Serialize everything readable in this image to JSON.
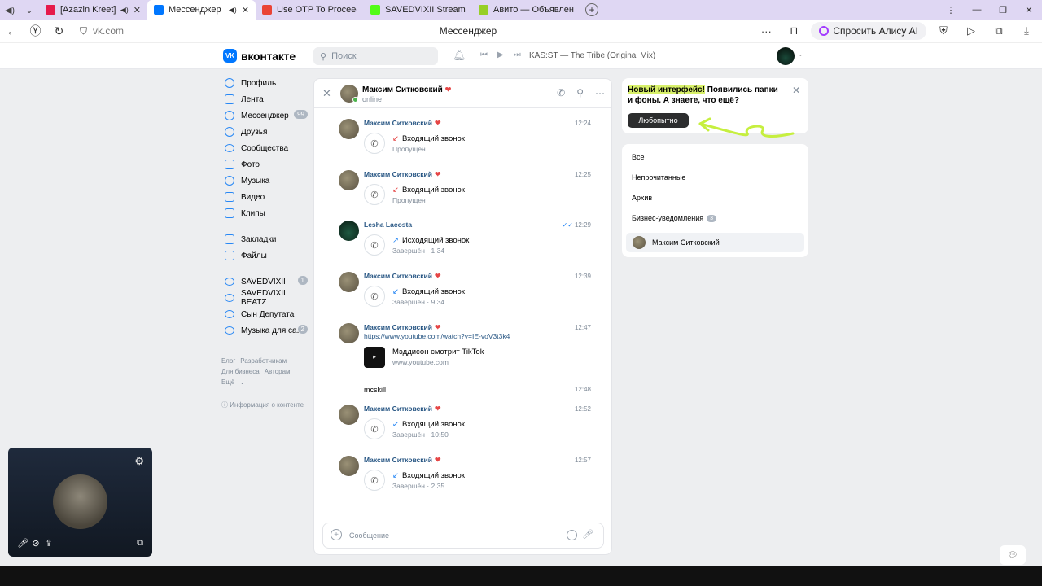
{
  "browser": {
    "tabs": [
      {
        "title": "[Azazin Kreet]Собес",
        "color": "#e6194b",
        "active": false
      },
      {
        "title": "Мессенджер",
        "color": "#0077ff",
        "active": true
      },
      {
        "title": "Use OTP To Proceed - you",
        "color": "#ea4335",
        "active": false
      },
      {
        "title": "SAVEDVIXII Stream - Wat",
        "color": "#53fc18",
        "active": false
      },
      {
        "title": "Авито — Объявления на",
        "color": "#97cf26",
        "active": false
      }
    ],
    "url": "vk.com",
    "page_title": "Мессенджер",
    "alisa_label": "Спросить Алису AI"
  },
  "vk_header": {
    "logo_text": "вконтакте",
    "logo_mark": "VK",
    "search_placeholder": "Поиск",
    "now_playing": "KAS:ST — The Tribe (Original Mix)"
  },
  "left_nav": {
    "main": [
      {
        "label": "Профиль",
        "icon": "profile-icon"
      },
      {
        "label": "Лента",
        "icon": "feed-icon"
      },
      {
        "label": "Мессенджер",
        "icon": "messenger-icon",
        "badge": "99"
      },
      {
        "label": "Друзья",
        "icon": "friends-icon"
      },
      {
        "label": "Сообщества",
        "icon": "communities-icon"
      },
      {
        "label": "Фото",
        "icon": "photo-icon"
      },
      {
        "label": "Музыка",
        "icon": "music-icon"
      },
      {
        "label": "Видео",
        "icon": "video-icon"
      },
      {
        "label": "Клипы",
        "icon": "clips-icon"
      }
    ],
    "secondary": [
      {
        "label": "Закладки",
        "icon": "bookmarks-icon"
      },
      {
        "label": "Файлы",
        "icon": "files-icon"
      }
    ],
    "groups": [
      {
        "label": "SAVEDVIXII",
        "badge": "1"
      },
      {
        "label": "SAVEDVIXII BEATZ"
      },
      {
        "label": "Сын Депутата"
      },
      {
        "label": "Музыка для са...",
        "badge": "2"
      }
    ],
    "footer": [
      "Блог",
      "Разработчикам",
      "Для бизнеса",
      "Авторам",
      "Ещё"
    ],
    "info": "Информация о контенте"
  },
  "chat": {
    "contact_name": "Максим Ситковский",
    "status": "online",
    "messages": [
      {
        "author": "Максим Ситковский",
        "time": "12:24",
        "call": "Входящий звонок",
        "sub": "Пропущен",
        "missed": true
      },
      {
        "author": "Максим Ситковский",
        "time": "12:25",
        "call": "Входящий звонок",
        "sub": "Пропущен",
        "missed": true
      },
      {
        "author": "Lesha Lacosta",
        "time": "12:29",
        "call": "Исходящий звонок",
        "sub": "Завершён · 1:34"
      },
      {
        "author": "Максим Ситковский",
        "time": "12:39",
        "call": "Входящий звонок",
        "sub": "Завершён · 9:34"
      },
      {
        "author": "Максим Ситковский",
        "time": "12:47",
        "link": "https://www.youtube.com/watch?v=IE-voV3t3k4",
        "snippet_title": "Мэддисон смотрит TikTok",
        "snippet_sub": "www.youtube.com"
      },
      {
        "text": "mcskill",
        "time": "12:48"
      },
      {
        "author": "Максим Ситковский",
        "time": "12:52",
        "call": "Входящий звонок",
        "sub": "Завершён · 10:50"
      },
      {
        "author": "Максим Ситковский",
        "time": "12:57",
        "call": "Входящий звонок",
        "sub": "Завершён · 2:35"
      }
    ],
    "composer_placeholder": "Сообщение"
  },
  "promo": {
    "highlight": "Новый интерфейс!",
    "text": " Появились папки и фоны. А знаете, что ещё?",
    "button": "Любопытно"
  },
  "folders": {
    "items": [
      {
        "label": "Все"
      },
      {
        "label": "Непрочитанные"
      },
      {
        "label": "Архив"
      },
      {
        "label": "Бизнес-уведомления",
        "badge": "3"
      }
    ],
    "contact": "Максим Ситковский"
  }
}
